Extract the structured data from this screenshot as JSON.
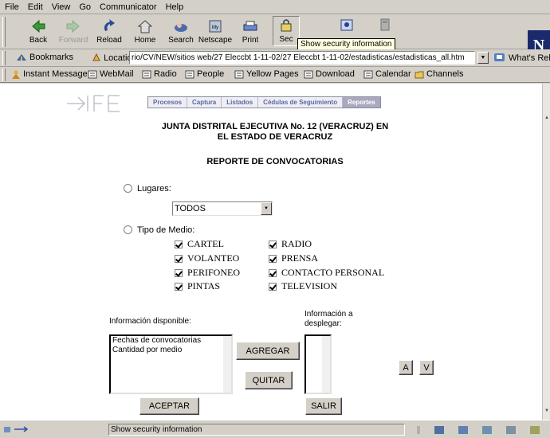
{
  "menu": [
    "File",
    "Edit",
    "View",
    "Go",
    "Communicator",
    "Help"
  ],
  "toolbar": {
    "buttons": [
      {
        "label": "Back",
        "icon": "back-arrow-icon"
      },
      {
        "label": "Forward",
        "icon": "forward-arrow-icon"
      },
      {
        "label": "Reload",
        "icon": "reload-icon"
      },
      {
        "label": "Home",
        "icon": "home-icon"
      },
      {
        "label": "Search",
        "icon": "search-icon"
      },
      {
        "label": "Netscape",
        "icon": "netscape-icon"
      },
      {
        "label": "Print",
        "icon": "print-icon"
      },
      {
        "label": "Sec",
        "icon": "security-lock-icon"
      }
    ],
    "tooltip": "Show security information",
    "logo": "N"
  },
  "location": {
    "bookmarks_label": "Bookmarks",
    "location_label": "Location:",
    "url": "rio/CV/NEW/sitios web/27 Eleccbt 1-11-02/27 Eleccbt 1-11-02/estadisticas/estadisticas_all.htm",
    "related_label": "What's Related"
  },
  "personal_bar": [
    "Instant Message",
    "WebMail",
    "Radio",
    "People",
    "Yellow Pages",
    "Download",
    "Calendar",
    "Channels"
  ],
  "page": {
    "nav_tabs": [
      "Procesos",
      "Captura",
      "Listados",
      "Cédulas de Seguimiento",
      "Reportes"
    ],
    "active_tab": "Reportes",
    "header_line1": "JUNTA DISTRITAL EJECUTIVA No. 12 (VERACRUZ) EN",
    "header_line2": "EL ESTADO DE VERACRUZ",
    "report_title": "REPORTE DE CONVOCATORIAS",
    "lugares_label": "Lugares:",
    "lugares_value": "TODOS",
    "tipo_label": "Tipo de Medio:",
    "medios_col1": [
      "CARTEL",
      "VOLANTEO",
      "PERIFONEO",
      "PINTAS"
    ],
    "medios_col2": [
      "RADIO",
      "PRENSA",
      "CONTACTO PERSONAL",
      "TELEVISION"
    ],
    "info_disponible_label": "Información disponible:",
    "info_desplegar_label_1": "Información a",
    "info_desplegar_label_2": "desplegar:",
    "info_disponible_items": [
      "Fechas de convocatorias",
      "Cantidad por medio"
    ],
    "agregar_label": "AGREGAR",
    "quitar_label": "QUITAR",
    "up_label": "A",
    "down_label": "V",
    "aceptar_label": "ACEPTAR",
    "salir_label": "SALIR"
  },
  "status": {
    "text": "Show security information"
  }
}
